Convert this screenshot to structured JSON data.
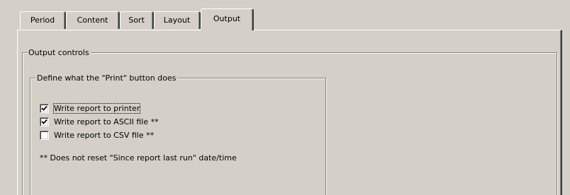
{
  "tabs": [
    {
      "label": "Period",
      "active": false
    },
    {
      "label": "Content",
      "active": false
    },
    {
      "label": "Sort",
      "active": false
    },
    {
      "label": "Layout",
      "active": false
    },
    {
      "label": "Output",
      "active": true
    }
  ],
  "output_controls": {
    "title": "Output controls",
    "print_group": {
      "title": "Define what the \"Print\" button does",
      "options": [
        {
          "label": "Write report to printer",
          "checked": true,
          "focused": true
        },
        {
          "label": "Write report to ASCII file **",
          "checked": true,
          "focused": false
        },
        {
          "label": "Write report to CSV file **",
          "checked": false,
          "focused": false
        }
      ],
      "note": "**  Does not reset \"Since report last run\" date/time"
    }
  },
  "icons": {
    "checkmark": "check-icon"
  }
}
